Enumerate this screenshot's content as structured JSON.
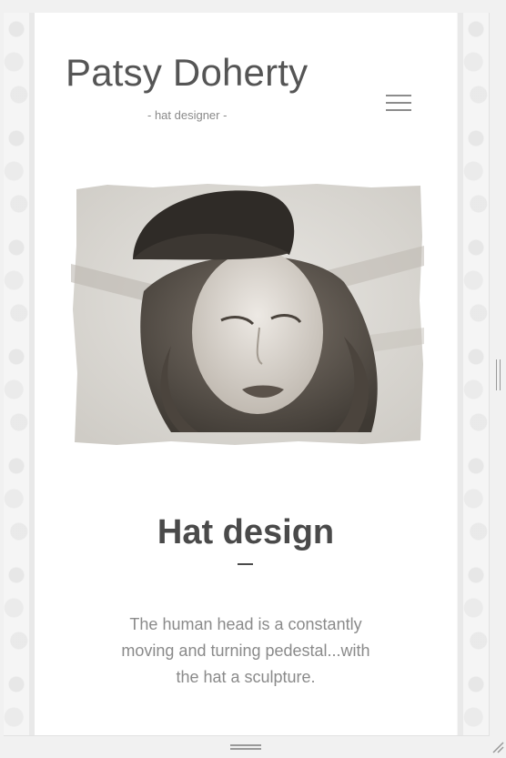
{
  "header": {
    "site_title": "Patsy Doherty",
    "tagline": "- hat designer -",
    "menu_icon": "hamburger-menu-icon"
  },
  "hero": {
    "image_description_icon": "portrait-photo"
  },
  "section": {
    "heading": "Hat design",
    "quote": "The human head is a constantly moving and turning pedestal...with the hat a sculpture."
  },
  "colors": {
    "page_background": "#ffffff",
    "outer_background": "#f1f1f1",
    "heading_text": "#4a4a4a",
    "body_text": "#8a8a8a"
  }
}
